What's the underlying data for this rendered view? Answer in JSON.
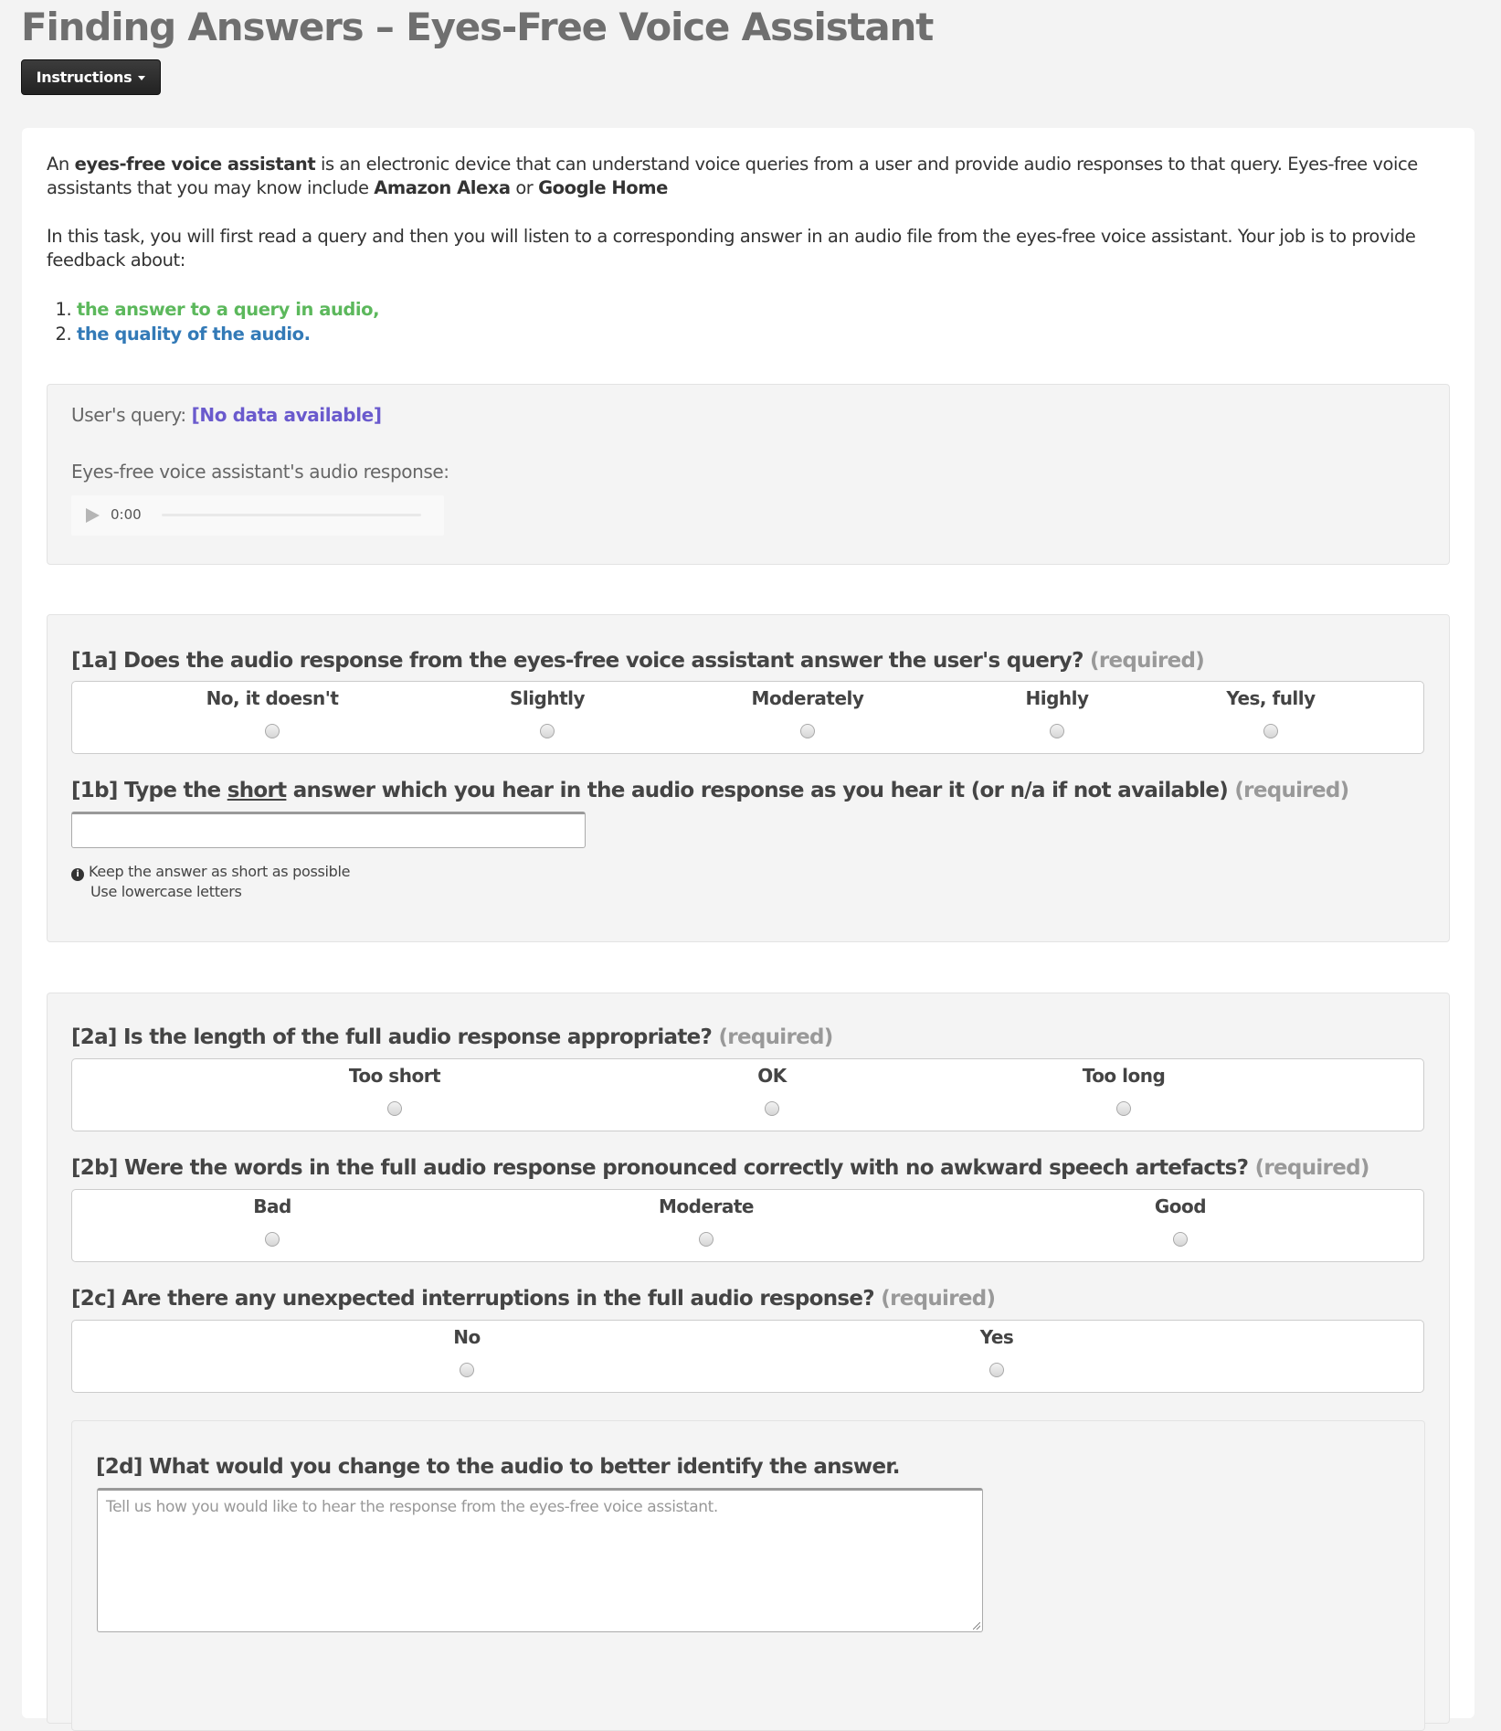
{
  "header": {
    "title": "Finding Answers – Eyes-Free Voice Assistant",
    "instructions_button": "Instructions"
  },
  "intro": {
    "p1_pre": "An ",
    "p1_bold1": "eyes-free voice assistant",
    "p1_mid": " is an electronic device that can understand voice queries from a user and provide audio responses to that query. Eyes-free voice assistants that you may know include ",
    "p1_bold2": "Amazon Alexa",
    "p1_or": " or ",
    "p1_bold3": "Google Home",
    "p2": "In this task, you will first read a query and then you will listen to a corresponding answer in an audio file from the eyes-free voice assistant. Your job is to provide feedback about:",
    "list": [
      {
        "text": "the answer to a query in audio,",
        "color": "#5cb85c"
      },
      {
        "text": "the quality of the audio.",
        "color": "#337ab7"
      }
    ]
  },
  "query_panel": {
    "query_label": "User's query:",
    "query_value": "[No data available]",
    "audio_label": "Eyes-free voice assistant's audio response:",
    "audio_time": "0:00",
    "audio_progress": 0
  },
  "required_label": "(required)",
  "q1a": {
    "text": "[1a] Does the audio response from the eyes-free voice assistant answer the user's query?",
    "options": [
      "No, it doesn't",
      "Slightly",
      "Moderately",
      "Highly",
      "Yes, fully"
    ]
  },
  "q1b": {
    "pre": "[1b] Type the ",
    "underlined": "short",
    "post": " answer which you hear in the audio response as you hear it (or n/a if not available)",
    "value": "",
    "hints": [
      "Keep the answer as short as possible",
      "Use lowercase letters"
    ]
  },
  "q2a": {
    "text": "[2a] Is the length of the full audio response appropriate?",
    "options": [
      "Too short",
      "OK",
      "Too long"
    ]
  },
  "q2b": {
    "text": "[2b] Were the words in the full audio response pronounced correctly with no awkward speech artefacts?",
    "options": [
      "Bad",
      "Moderate",
      "Good"
    ]
  },
  "q2c": {
    "text": "[2c] Are there any unexpected interruptions in the full audio response?",
    "options": [
      "No",
      "Yes"
    ]
  },
  "q2d": {
    "text": "[2d] What would you change to the audio to better identify the answer.",
    "placeholder": "Tell us how you would like to hear the response from the eyes-free voice assistant.",
    "value": ""
  }
}
